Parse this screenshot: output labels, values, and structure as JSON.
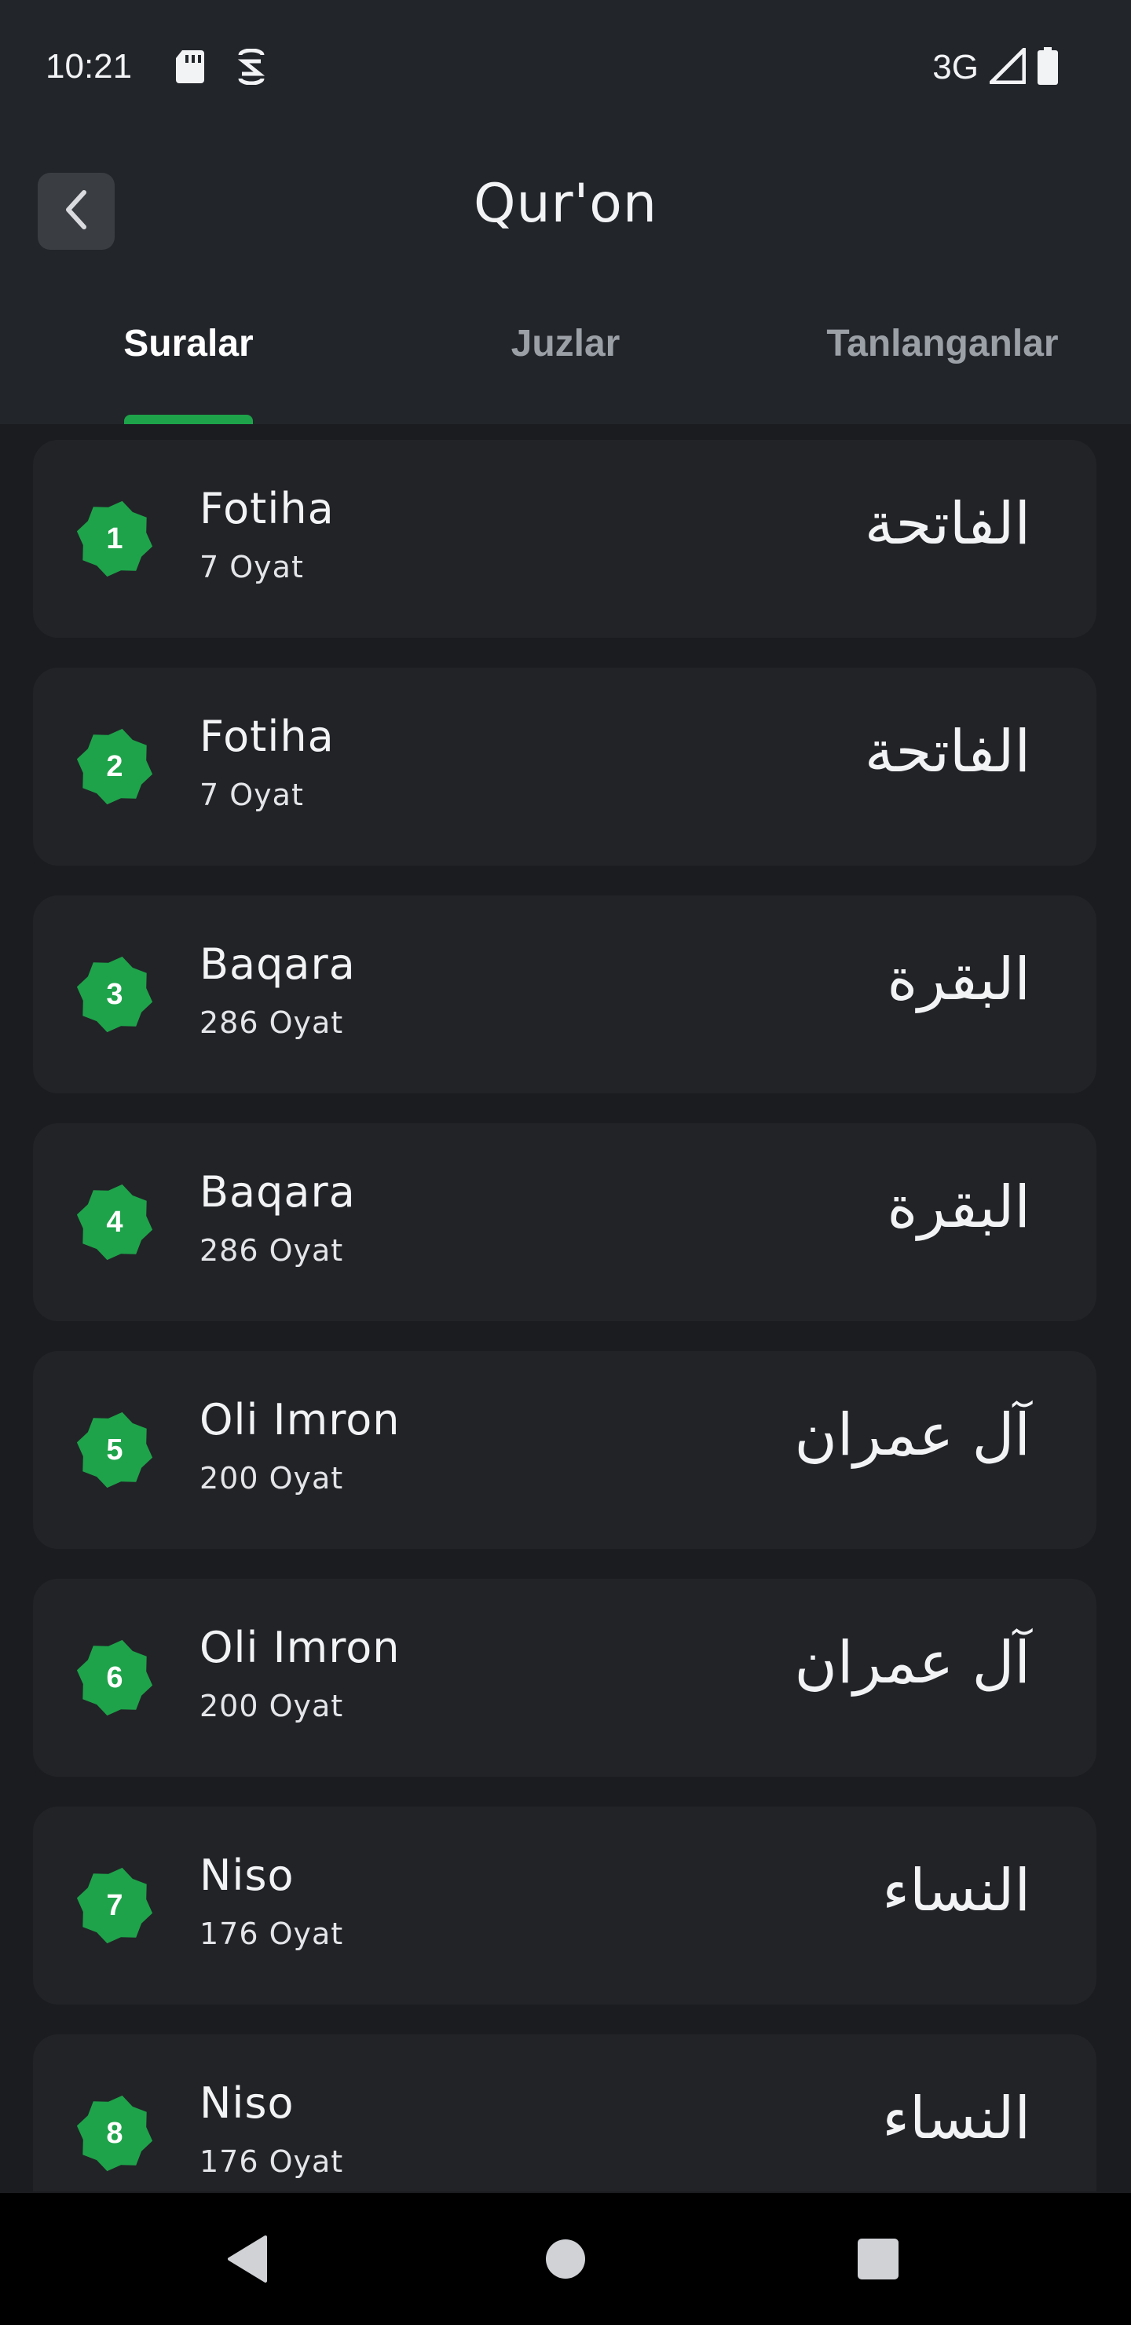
{
  "status_bar": {
    "time": "10:21",
    "network": "3G",
    "icons": [
      "sd-card-icon",
      "sim-icon",
      "signal-icon",
      "battery-icon"
    ]
  },
  "app_bar": {
    "title": "Qur'on",
    "back_icon": "chevron-left-icon"
  },
  "tabs": [
    {
      "label": "Suralar",
      "active": true
    },
    {
      "label": "Juzlar",
      "active": false
    },
    {
      "label": "Tanlanganlar",
      "active": false
    }
  ],
  "surahs": [
    {
      "number": "1",
      "name": "Fotiha",
      "verses": "7 Oyat",
      "arabic": "الفاتحة"
    },
    {
      "number": "2",
      "name": "Fotiha",
      "verses": "7 Oyat",
      "arabic": "الفاتحة"
    },
    {
      "number": "3",
      "name": "Baqara",
      "verses": "286 Oyat",
      "arabic": "البقرة"
    },
    {
      "number": "4",
      "name": "Baqara",
      "verses": "286 Oyat",
      "arabic": "البقرة"
    },
    {
      "number": "5",
      "name": "Oli Imron",
      "verses": "200 Oyat",
      "arabic": "آل عمران"
    },
    {
      "number": "6",
      "name": "Oli Imron",
      "verses": "200 Oyat",
      "arabic": "آل عمران"
    },
    {
      "number": "7",
      "name": "Niso",
      "verses": "176 Oyat",
      "arabic": "النساء"
    },
    {
      "number": "8",
      "name": "Niso",
      "verses": "176 Oyat",
      "arabic": "النساء"
    }
  ],
  "colors": {
    "accent": "#1ea34a",
    "background": "#1b1c20",
    "card": "#222327",
    "header": "#22252a"
  },
  "nav_bar": {
    "icons": [
      "back-triangle-icon",
      "home-circle-icon",
      "recents-square-icon"
    ]
  }
}
